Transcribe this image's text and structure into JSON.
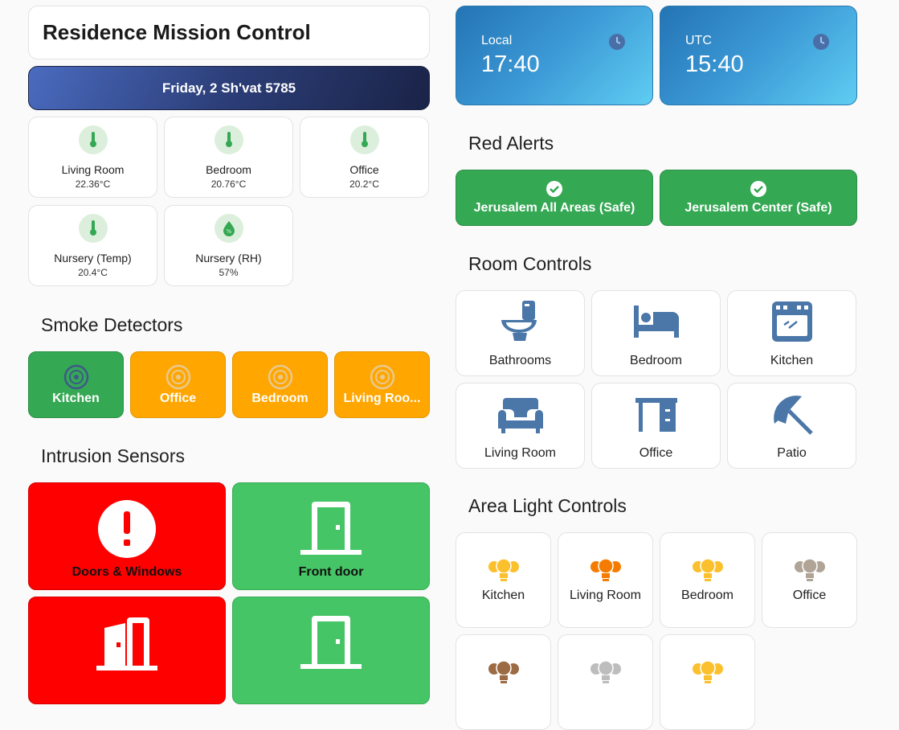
{
  "header": {
    "title": "Residence Mission Control",
    "date": "Friday, 2 Sh'vat 5785"
  },
  "sensors": [
    {
      "name": "Living Room",
      "value": "22.36°C",
      "icon": "thermometer-icon"
    },
    {
      "name": "Bedroom",
      "value": "20.76°C",
      "icon": "thermometer-icon"
    },
    {
      "name": "Office",
      "value": "20.2°C",
      "icon": "thermometer-icon"
    },
    {
      "name": "Nursery (Temp)",
      "value": "20.4°C",
      "icon": "thermometer-icon"
    },
    {
      "name": "Nursery (RH)",
      "value": "57%",
      "icon": "water-percent-icon"
    }
  ],
  "smoke": {
    "title": "Smoke Detectors",
    "items": [
      {
        "label": "Kitchen",
        "status": "ok",
        "color": "#34a853"
      },
      {
        "label": "Office",
        "status": "warn",
        "color": "#ffa600"
      },
      {
        "label": "Bedroom",
        "status": "warn",
        "color": "#ffa600"
      },
      {
        "label": "Living Roo...",
        "status": "warn",
        "color": "#ffa600"
      }
    ]
  },
  "intrusion": {
    "title": "Intrusion Sensors",
    "items": [
      {
        "label": "Doors & Windows",
        "state": "alert",
        "color": "#ff0000",
        "icon": "alert-circle-icon"
      },
      {
        "label": "Front door",
        "state": "safe",
        "color": "#45c565",
        "icon": "door-closed-icon"
      },
      {
        "label": "",
        "state": "alert",
        "color": "#ff0000",
        "icon": "door-open-icon"
      },
      {
        "label": "",
        "state": "safe",
        "color": "#45c565",
        "icon": "door-closed-icon"
      }
    ]
  },
  "clocks": [
    {
      "label": "Local",
      "time": "17:40"
    },
    {
      "label": "UTC",
      "time": "15:40"
    }
  ],
  "red_alerts": {
    "title": "Red Alerts",
    "items": [
      {
        "label": "Jerusalem All Areas (Safe)"
      },
      {
        "label": "Jerusalem Center (Safe)"
      }
    ]
  },
  "rooms": {
    "title": "Room Controls",
    "icon_color": "#4a76a8",
    "items": [
      {
        "label": "Bathrooms",
        "icon": "toilet-icon"
      },
      {
        "label": "Bedroom",
        "icon": "bed-icon"
      },
      {
        "label": "Kitchen",
        "icon": "stove-icon"
      },
      {
        "label": "Living Room",
        "icon": "sofa-icon"
      },
      {
        "label": "Office",
        "icon": "desk-icon"
      },
      {
        "label": "Patio",
        "icon": "umbrella-icon"
      }
    ]
  },
  "lights": {
    "title": "Area Light Controls",
    "items": [
      {
        "label": "Kitchen",
        "color": "#fbc02d"
      },
      {
        "label": "Living Room",
        "color": "#f57c00"
      },
      {
        "label": "Bedroom",
        "color": "#fbc02d"
      },
      {
        "label": "Office",
        "color": "#b0a497"
      },
      {
        "label": "",
        "color": "#9c6b43"
      },
      {
        "label": "",
        "color": "#bdbdbd"
      },
      {
        "label": "",
        "color": "#fbc02d"
      }
    ]
  }
}
